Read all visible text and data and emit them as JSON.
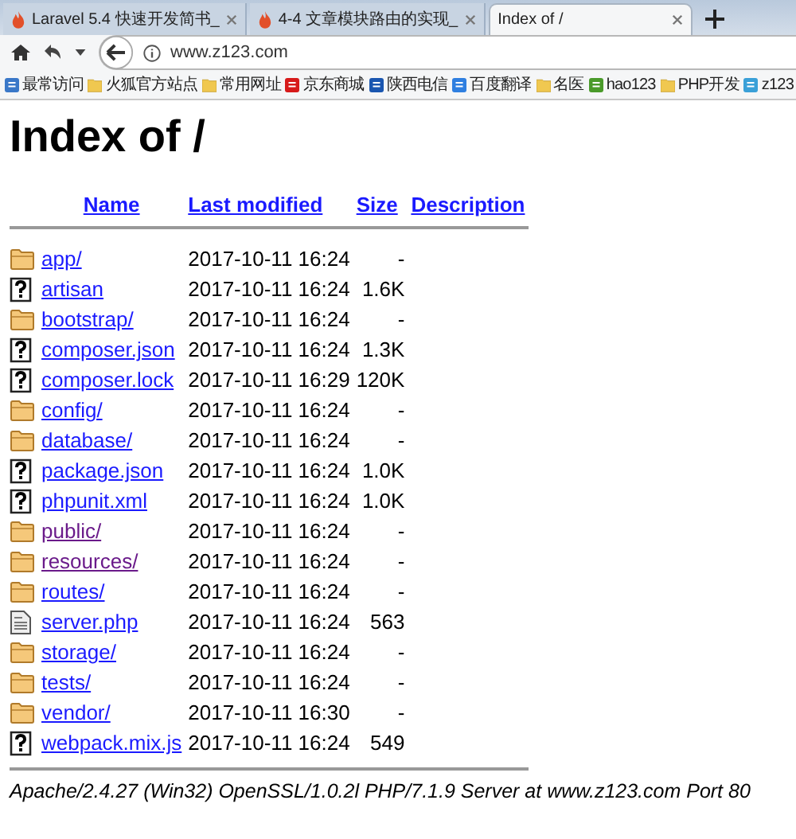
{
  "tabs": [
    {
      "label": "Laravel 5.4 快速开发简书_",
      "selected": false
    },
    {
      "label": "4-4 文章模块路由的实现_",
      "selected": false
    },
    {
      "label": "Index of /",
      "selected": true
    }
  ],
  "address": {
    "value": "www.z123.com"
  },
  "bookmarks": [
    {
      "label": "最常访问",
      "kind": "smart"
    },
    {
      "label": "火狐官方站点",
      "kind": "folder"
    },
    {
      "label": "常用网址",
      "kind": "folder"
    },
    {
      "label": "京东商城",
      "kind": "jd"
    },
    {
      "label": "陕西电信",
      "kind": "telecom"
    },
    {
      "label": "百度翻译",
      "kind": "translate"
    },
    {
      "label": "名医",
      "kind": "folder"
    },
    {
      "label": "hao123",
      "kind": "hao"
    },
    {
      "label": "PHP开发",
      "kind": "folder"
    },
    {
      "label": "z123",
      "kind": "site"
    }
  ],
  "heading": "Index of /",
  "columns": [
    "Name",
    "Last modified",
    "Size",
    "Description"
  ],
  "rows": [
    {
      "name": "app/",
      "kind": "folder",
      "visited": false,
      "modified": "2017-10-11 16:24",
      "size": "-"
    },
    {
      "name": "artisan",
      "kind": "unknown",
      "visited": false,
      "modified": "2017-10-11 16:24",
      "size": "1.6K"
    },
    {
      "name": "bootstrap/",
      "kind": "folder",
      "visited": false,
      "modified": "2017-10-11 16:24",
      "size": "-"
    },
    {
      "name": "composer.json",
      "kind": "unknown",
      "visited": false,
      "modified": "2017-10-11 16:24",
      "size": "1.3K"
    },
    {
      "name": "composer.lock",
      "kind": "unknown",
      "visited": false,
      "modified": "2017-10-11 16:29",
      "size": "120K"
    },
    {
      "name": "config/",
      "kind": "folder",
      "visited": false,
      "modified": "2017-10-11 16:24",
      "size": "-"
    },
    {
      "name": "database/",
      "kind": "folder",
      "visited": false,
      "modified": "2017-10-11 16:24",
      "size": "-"
    },
    {
      "name": "package.json",
      "kind": "unknown",
      "visited": false,
      "modified": "2017-10-11 16:24",
      "size": "1.0K"
    },
    {
      "name": "phpunit.xml",
      "kind": "unknown",
      "visited": false,
      "modified": "2017-10-11 16:24",
      "size": "1.0K"
    },
    {
      "name": "public/",
      "kind": "folder",
      "visited": true,
      "modified": "2017-10-11 16:24",
      "size": "-"
    },
    {
      "name": "resources/",
      "kind": "folder",
      "visited": true,
      "modified": "2017-10-11 16:24",
      "size": "-"
    },
    {
      "name": "routes/",
      "kind": "folder",
      "visited": false,
      "modified": "2017-10-11 16:24",
      "size": "-"
    },
    {
      "name": "server.php",
      "kind": "text",
      "visited": false,
      "modified": "2017-10-11 16:24",
      "size": "563"
    },
    {
      "name": "storage/",
      "kind": "folder",
      "visited": false,
      "modified": "2017-10-11 16:24",
      "size": "-"
    },
    {
      "name": "tests/",
      "kind": "folder",
      "visited": false,
      "modified": "2017-10-11 16:24",
      "size": "-"
    },
    {
      "name": "vendor/",
      "kind": "folder",
      "visited": false,
      "modified": "2017-10-11 16:30",
      "size": "-"
    },
    {
      "name": "webpack.mix.js",
      "kind": "unknown",
      "visited": false,
      "modified": "2017-10-11 16:24",
      "size": "549"
    }
  ],
  "footer": "Apache/2.4.27 (Win32) OpenSSL/1.0.2l PHP/7.1.9 Server at www.z123.com Port 80"
}
